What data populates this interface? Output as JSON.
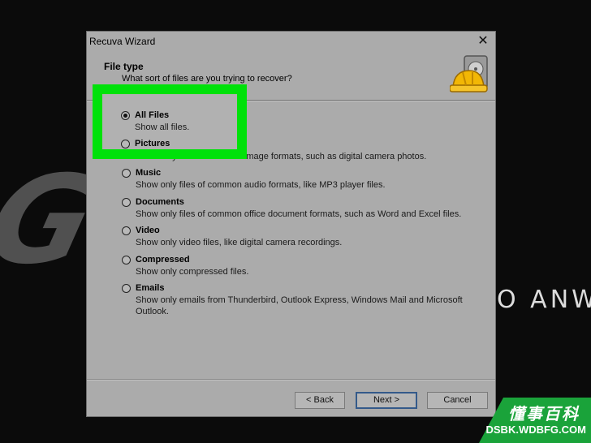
{
  "background": {
    "big_text": "GUILA",
    "sub_text": "KO ANWA"
  },
  "window": {
    "title": "Recuva Wizard",
    "close_glyph": "✕"
  },
  "header": {
    "title": "File type",
    "subtitle": "What sort of files are you trying to recover?",
    "icon": "hard-drive-helmet-icon"
  },
  "options": [
    {
      "label": "All Files",
      "desc": "Show all files.",
      "checked": true
    },
    {
      "label": "Pictures",
      "desc": "Show only files of common image formats, such as digital camera photos.",
      "checked": false
    },
    {
      "label": "Music",
      "desc": "Show only files of common audio formats, like MP3 player files.",
      "checked": false
    },
    {
      "label": "Documents",
      "desc": "Show only files of common office document formats, such as Word and Excel files.",
      "checked": false
    },
    {
      "label": "Video",
      "desc": "Show only video files, like digital camera recordings.",
      "checked": false
    },
    {
      "label": "Compressed",
      "desc": "Show only compressed files.",
      "checked": false
    },
    {
      "label": "Emails",
      "desc": "Show only emails from Thunderbird, Outlook Express, Windows Mail and Microsoft Outlook.",
      "checked": false
    }
  ],
  "buttons": {
    "back": "< Back",
    "next": "Next >",
    "cancel": "Cancel"
  },
  "highlight_color": "#00e10a",
  "watermark": {
    "cn": "懂事百科",
    "en": "DSBK.WDBFG.COM"
  }
}
